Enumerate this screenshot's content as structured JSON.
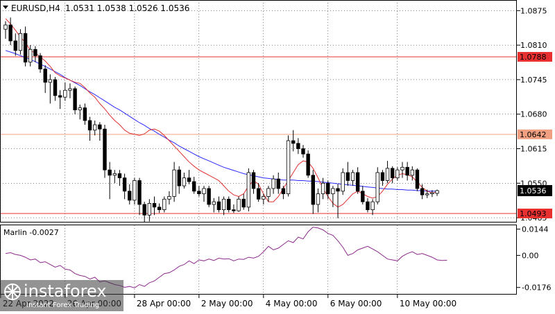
{
  "header": {
    "symbol": "EURUSD,H4",
    "ohlc": "1.0531 1.0538 1.0526 1.0536"
  },
  "indicator_label": "Marlin -0.0027",
  "watermark": {
    "brand": "instaforex",
    "tagline": "Instant Forex Trading"
  },
  "colors": {
    "bull": "#ffffff",
    "bear": "#000000",
    "ma_fast": "#e03030",
    "ma_slow": "#2a2aff",
    "level": "#e83030",
    "level_orange": "#f0a080",
    "marlin": "#8b2a8b",
    "price_tag": "#000000"
  },
  "chart_data": [
    {
      "type": "candlestick",
      "title": "EURUSD,H4",
      "ylim": [
        1.0476,
        1.0895
      ],
      "y_ticks": [
        "1.0875",
        "1.0810",
        "1.0745",
        "1.0680",
        "1.0615",
        "1.0550",
        "1.0485"
      ],
      "x_ticks": [
        "22 Apr 2022",
        "26 Apr 00:00",
        "28 Apr 00:00",
        "2 May 00:00",
        "4 May 00:00",
        "6 May 00:00",
        "10 May 00:00"
      ],
      "levels": [
        {
          "label": "1.0788",
          "value": 1.0788,
          "color": "#e83030"
        },
        {
          "label": "1.0642",
          "value": 1.0642,
          "color": "#f0a080"
        },
        {
          "label": "1.0493",
          "value": 1.0493,
          "color": "#e83030"
        }
      ],
      "current_price": {
        "label": "1.0536",
        "value": 1.0536
      },
      "candles": [
        [
          1.084,
          1.0855,
          1.0822,
          1.0848
        ],
        [
          1.0848,
          1.0862,
          1.081,
          1.0818
        ],
        [
          1.0818,
          1.0832,
          1.079,
          1.08
        ],
        [
          1.08,
          1.084,
          1.0792,
          1.0832
        ],
        [
          1.0832,
          1.0845,
          1.077,
          1.0778
        ],
        [
          1.0778,
          1.081,
          1.077,
          1.0802
        ],
        [
          1.0802,
          1.0808,
          1.0778,
          1.079
        ],
        [
          1.079,
          1.0795,
          1.0758,
          1.0765
        ],
        [
          1.0765,
          1.0772,
          1.072,
          1.074
        ],
        [
          1.074,
          1.0755,
          1.07,
          1.0745
        ],
        [
          1.0745,
          1.075,
          1.0705,
          1.0715
        ],
        [
          1.0715,
          1.0725,
          1.069,
          1.0712
        ],
        [
          1.0712,
          1.074,
          1.0705,
          1.0725
        ],
        [
          1.0725,
          1.0738,
          1.071,
          1.0728
        ],
        [
          1.0728,
          1.0732,
          1.068,
          1.0688
        ],
        [
          1.0688,
          1.0698,
          1.067,
          1.0692
        ],
        [
          1.0692,
          1.07,
          1.066,
          1.0668
        ],
        [
          1.0668,
          1.0675,
          1.063,
          1.065
        ],
        [
          1.065,
          1.0668,
          1.064,
          1.066
        ],
        [
          1.066,
          1.0665,
          1.063,
          1.0652
        ],
        [
          1.0652,
          1.066,
          1.056,
          1.0575
        ],
        [
          1.0575,
          1.059,
          1.052,
          1.0565
        ],
        [
          1.0565,
          1.0575,
          1.055,
          1.0568
        ],
        [
          1.0568,
          1.0575,
          1.0545,
          1.056
        ],
        [
          1.056,
          1.0568,
          1.052,
          1.0535
        ],
        [
          1.0535,
          1.0548,
          1.051,
          1.0518
        ],
        [
          1.0518,
          1.056,
          1.051,
          1.0555
        ],
        [
          1.0555,
          1.056,
          1.049,
          1.051
        ],
        [
          1.051,
          1.0515,
          1.0476,
          1.049
        ],
        [
          1.049,
          1.052,
          1.0478,
          1.0512
        ],
        [
          1.0512,
          1.0525,
          1.049,
          1.0505
        ],
        [
          1.0505,
          1.0512,
          1.0494,
          1.05
        ],
        [
          1.05,
          1.0525,
          1.0495,
          1.052
        ],
        [
          1.052,
          1.0535,
          1.051,
          1.0525
        ],
        [
          1.0525,
          1.059,
          1.0515,
          1.0575
        ],
        [
          1.0575,
          1.0582,
          1.053,
          1.0545
        ],
        [
          1.0545,
          1.057,
          1.054,
          1.056
        ],
        [
          1.056,
          1.0575,
          1.0548,
          1.0553
        ],
        [
          1.0553,
          1.0562,
          1.053,
          1.0535
        ],
        [
          1.0535,
          1.0545,
          1.0525,
          1.053
        ],
        [
          1.053,
          1.0545,
          1.0515,
          1.054
        ],
        [
          1.054,
          1.0545,
          1.0505,
          1.051
        ],
        [
          1.051,
          1.0522,
          1.0495,
          1.0515
        ],
        [
          1.0515,
          1.0525,
          1.0495,
          1.05
        ],
        [
          1.05,
          1.0525,
          1.049,
          1.052
        ],
        [
          1.052,
          1.0525,
          1.0495,
          1.05
        ],
        [
          1.05,
          1.051,
          1.0494,
          1.0498
        ],
        [
          1.0498,
          1.0525,
          1.0496,
          1.052
        ],
        [
          1.052,
          1.053,
          1.05,
          1.0505
        ],
        [
          1.0505,
          1.0578,
          1.0497,
          1.057
        ],
        [
          1.057,
          1.0575,
          1.053,
          1.054
        ],
        [
          1.054,
          1.055,
          1.0515,
          1.052
        ],
        [
          1.052,
          1.053,
          1.051,
          1.0525
        ],
        [
          1.0525,
          1.0545,
          1.0515,
          1.054
        ],
        [
          1.054,
          1.0565,
          1.053,
          1.0558
        ],
        [
          1.0558,
          1.057,
          1.053,
          1.054
        ],
        [
          1.054,
          1.0545,
          1.052,
          1.053
        ],
        [
          1.053,
          1.064,
          1.0525,
          1.063
        ],
        [
          1.063,
          1.065,
          1.061,
          1.0625
        ],
        [
          1.0625,
          1.0635,
          1.0605,
          1.0615
        ],
        [
          1.0615,
          1.0622,
          1.0598,
          1.0605
        ],
        [
          1.0605,
          1.0612,
          1.056,
          1.0565
        ],
        [
          1.0565,
          1.0575,
          1.0492,
          1.051
        ],
        [
          1.051,
          1.054,
          1.0495,
          1.053
        ],
        [
          1.053,
          1.056,
          1.052,
          1.055
        ],
        [
          1.055,
          1.0555,
          1.052,
          1.053
        ],
        [
          1.053,
          1.0545,
          1.0505,
          1.054
        ],
        [
          1.054,
          1.0548,
          1.0484,
          1.0535
        ],
        [
          1.0535,
          1.0578,
          1.0528,
          1.057
        ],
        [
          1.057,
          1.059,
          1.0545,
          1.0555
        ],
        [
          1.0555,
          1.0575,
          1.0545,
          1.057
        ],
        [
          1.057,
          1.058,
          1.053,
          1.0535
        ],
        [
          1.0535,
          1.0545,
          1.051,
          1.0515
        ],
        [
          1.0515,
          1.0522,
          1.0495,
          1.05
        ],
        [
          1.05,
          1.052,
          1.049,
          1.0515
        ],
        [
          1.0515,
          1.058,
          1.051,
          1.057
        ],
        [
          1.057,
          1.0575,
          1.0545,
          1.0555
        ],
        [
          1.0555,
          1.0592,
          1.055,
          1.0578
        ],
        [
          1.0578,
          1.0582,
          1.055,
          1.056
        ],
        [
          1.056,
          1.058,
          1.0555,
          1.0575
        ],
        [
          1.0575,
          1.059,
          1.056,
          1.058
        ],
        [
          1.058,
          1.059,
          1.0555,
          1.0565
        ],
        [
          1.0565,
          1.0582,
          1.0555,
          1.0575
        ],
        [
          1.0575,
          1.0578,
          1.0535,
          1.054
        ],
        [
          1.054,
          1.0548,
          1.052,
          1.0528
        ],
        [
          1.0528,
          1.0538,
          1.0522,
          1.053
        ],
        [
          1.053,
          1.0537,
          1.0524,
          1.0532
        ],
        [
          1.0531,
          1.0538,
          1.0526,
          1.0536
        ]
      ],
      "ma_fast": [
        1.086,
        1.085,
        1.0838,
        1.0825,
        1.0815,
        1.08,
        1.0795,
        1.0788,
        1.078,
        1.077,
        1.0758,
        1.0752,
        1.0748,
        1.0744,
        1.074,
        1.0738,
        1.073,
        1.072,
        1.0712,
        1.07,
        1.069,
        1.0678,
        1.0668,
        1.066,
        1.065,
        1.0644,
        1.0642,
        1.064,
        1.0643,
        1.065,
        1.0652,
        1.0648,
        1.064,
        1.063,
        1.062,
        1.061,
        1.06,
        1.059,
        1.0582,
        1.0575,
        1.057,
        1.0565,
        1.056,
        1.0555,
        1.0545,
        1.0535,
        1.0528,
        1.0525,
        1.053,
        1.0545,
        1.0555,
        1.0548,
        1.053,
        1.0515,
        1.0515,
        1.0525,
        1.054,
        1.0555,
        1.057,
        1.0585,
        1.0592,
        1.059,
        1.0578,
        1.056,
        1.054,
        1.0525,
        1.0512,
        1.0505,
        1.051,
        1.052,
        1.053,
        1.0535,
        1.053,
        1.0525,
        1.0522,
        1.0525,
        1.0535,
        1.0548,
        1.0558,
        1.0565,
        1.0568,
        1.0566,
        1.0562,
        1.0552,
        1.0542,
        1.0535,
        1.0532,
        1.0533
      ],
      "ma_slow": [
        1.08,
        1.0797,
        1.0794,
        1.079,
        1.0787,
        1.0783,
        1.0779,
        1.0774,
        1.077,
        1.0765,
        1.076,
        1.0755,
        1.0749,
        1.0744,
        1.0739,
        1.0734,
        1.0728,
        1.0722,
        1.0717,
        1.0711,
        1.0705,
        1.0699,
        1.0693,
        1.0688,
        1.0682,
        1.0676,
        1.067,
        1.0664,
        1.0659,
        1.0653,
        1.0648,
        1.0642,
        1.0637,
        1.0631,
        1.0626,
        1.062,
        1.0615,
        1.061,
        1.0605,
        1.06,
        1.0596,
        1.0592,
        1.0588,
        1.0584,
        1.058,
        1.0577,
        1.0574,
        1.0571,
        1.0568,
        1.0566,
        1.0564,
        1.0562,
        1.056,
        1.0559,
        1.0558,
        1.0557,
        1.0556,
        1.0556,
        1.0556,
        1.0555,
        1.0555,
        1.0554,
        1.0554,
        1.0553,
        1.0552,
        1.0551,
        1.055,
        1.0549,
        1.0548,
        1.0547,
        1.0546,
        1.0545,
        1.0544,
        1.0543,
        1.0542,
        1.0541,
        1.054,
        1.0539,
        1.0539,
        1.0538,
        1.0538,
        1.0537,
        1.0537,
        1.0536,
        1.0536,
        1.0535,
        1.0535,
        1.0535
      ]
    },
    {
      "type": "line",
      "title": "Marlin -0.0027",
      "ylim": [
        -0.0215,
        0.0165
      ],
      "y_ticks": [
        "0.0144",
        "0.00",
        "-0.0176"
      ],
      "series": [
        {
          "values": [
            0.001,
            0.0015,
            0.0005,
            0.0,
            -0.001,
            -0.0025,
            -0.002,
            -0.004,
            -0.0035,
            -0.005,
            -0.0065,
            -0.0055,
            -0.0075,
            -0.008,
            -0.01,
            -0.011,
            -0.0115,
            -0.013,
            -0.012,
            -0.0145,
            -0.014,
            -0.015,
            -0.016,
            -0.0165,
            -0.0175,
            -0.017,
            -0.0178,
            -0.016,
            -0.017,
            -0.015,
            -0.014,
            -0.012,
            -0.01,
            -0.0095,
            -0.008,
            -0.006,
            -0.005,
            -0.003,
            -0.0045,
            -0.0025,
            -0.003,
            -0.002,
            -0.0028,
            -0.0015,
            -0.002,
            -0.0018,
            -0.003,
            -0.002,
            -0.0022,
            -0.001,
            -0.0015,
            -0.0005,
            0.002,
            0.005,
            0.003,
            0.004,
            0.006,
            0.008,
            0.007,
            0.01,
            0.009,
            0.013,
            0.0155,
            0.015,
            0.014,
            0.012,
            0.011,
            0.008,
            0.0045,
            0.0,
            0.001,
            0.003,
            0.004,
            0.005,
            0.0035,
            0.002,
            0.0,
            -0.002,
            -0.0025,
            -0.003,
            -0.0005,
            0.001,
            0.002,
            0.0005,
            0.001,
            0.0,
            -0.001,
            -0.0025,
            -0.0028,
            -0.0027
          ]
        }
      ]
    }
  ]
}
